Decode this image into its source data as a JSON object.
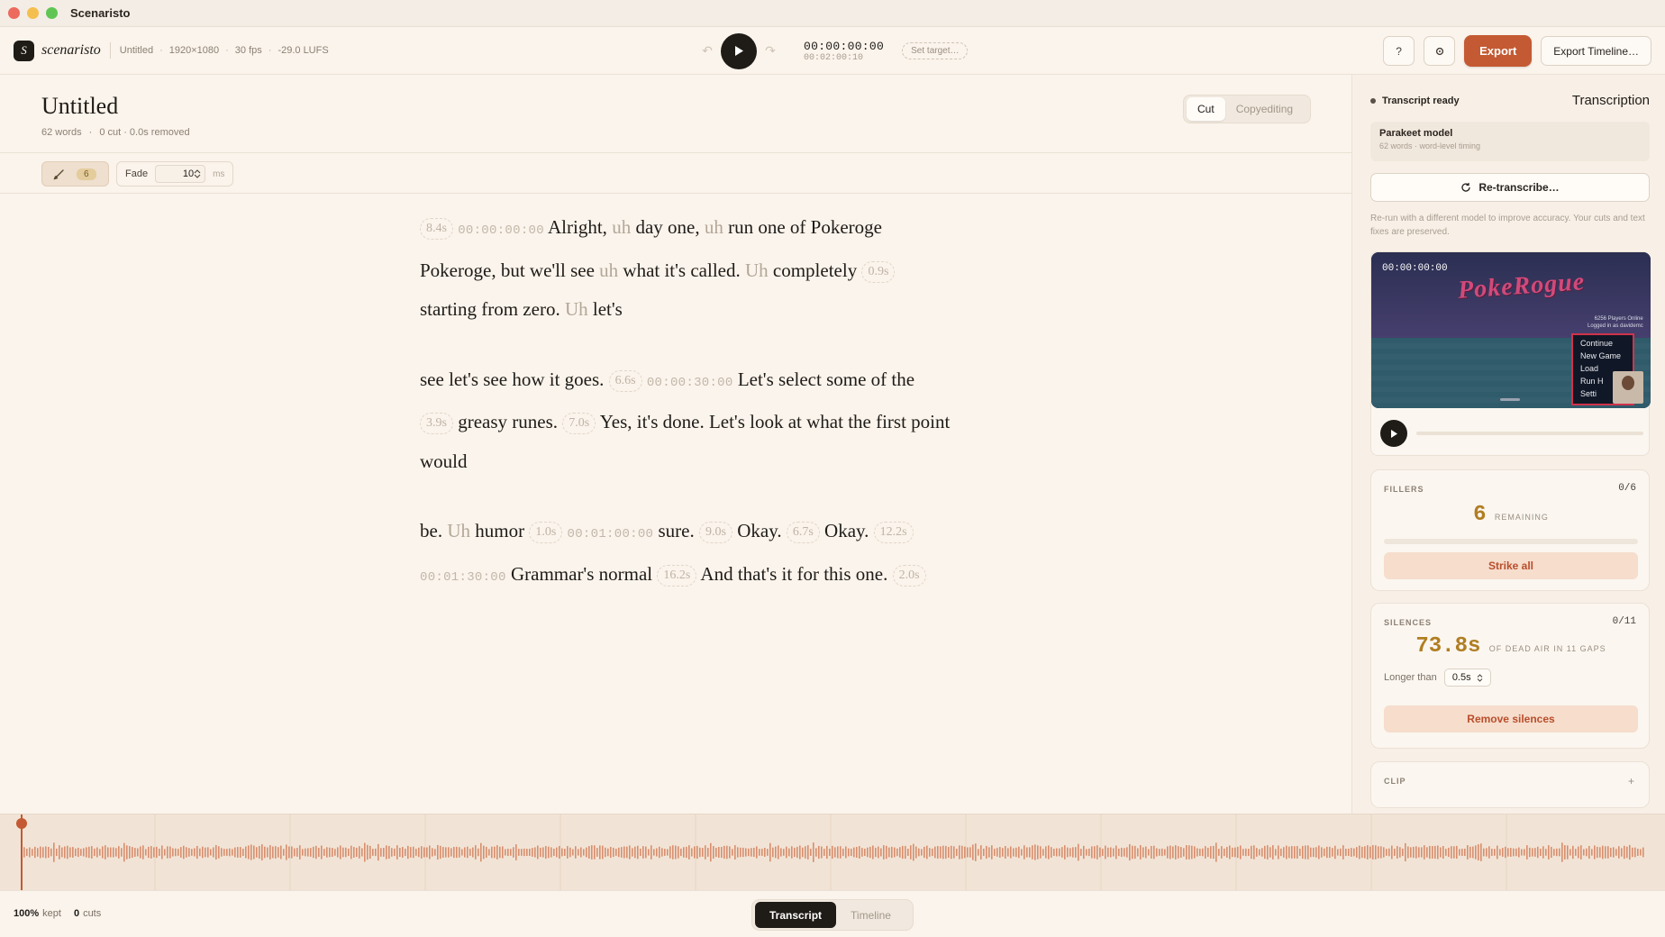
{
  "window": {
    "title": "Scenaristo"
  },
  "header": {
    "logo_letter": "S",
    "brand": "scenaristo",
    "project": "Untitled",
    "resolution": "1920×1080",
    "fps": "30 fps",
    "loudness": "-29.0 LUFS",
    "timecode": "00:00:00:00",
    "duration": "00:02:00:10",
    "set_target": "Set target…",
    "help": "?",
    "export": "Export",
    "export_timeline": "Export Timeline…"
  },
  "document": {
    "title": "Untitled",
    "words": "62 words",
    "cut_summary": "0 cut · 0.0s removed",
    "modes": [
      "Cut",
      "Copyediting"
    ],
    "filler_count": "6",
    "fade_label": "Fade",
    "fade_value": "10",
    "fade_unit": "ms"
  },
  "transcript": {
    "g1": "8.4s",
    "t1": "00:00:00:00",
    "w1": "Alright,",
    "f1": "uh",
    "w2": "day one,",
    "f2": "uh",
    "w3": "run one of Pokeroge Pokeroge, but we'll see",
    "f3": "uh",
    "w4": "what it's called.",
    "f4": "Uh",
    "w5": "completely",
    "g2": "0.9s",
    "w6": "starting from zero.",
    "f5": "Uh",
    "w7": "let's",
    "w8": "see let's see how it goes.",
    "g3": "6.6s",
    "t2": "00:00:30:00",
    "w9": "Let's select some of the",
    "g4": "3.9s",
    "w10": "greasy runes.",
    "g5": "7.0s",
    "w11": "Yes, it's done. Let's look at what the first point would",
    "w12": "be.",
    "f6": "Uh",
    "w13": "humor",
    "g6": "1.0s",
    "t3": "00:01:00:00",
    "w14": "sure.",
    "g7": "9.0s",
    "w15": "Okay.",
    "g8": "6.7s",
    "w16": "Okay.",
    "g9": "12.2s",
    "t4": "00:01:30:00",
    "w17": "Grammar's normal",
    "g10": "16.2s",
    "w18": "And that's it for this one.",
    "g11": "2.0s"
  },
  "sidebar": {
    "status": "Transcript ready",
    "title": "Transcription",
    "model_name": "Parakeet model",
    "model_sub": "62 words · word-level timing",
    "retranscribe": "Re-transcribe…",
    "note": "Re-run with a different model to improve accuracy. Your cuts and text fixes are preserved.",
    "video": {
      "timecode": "00:00:00:00",
      "game_logo": "PokeRogue",
      "online": "6256 Players Online",
      "logged": "Logged in as davidemc",
      "menu": [
        "Continue",
        "New Game",
        "Load",
        "Run H",
        "Setti"
      ]
    },
    "fillers": {
      "label": "FILLERS",
      "count": "0/6",
      "number": "6",
      "caption": "REMAINING",
      "progress": 0,
      "action": "Strike all"
    },
    "silences": {
      "label": "SILENCES",
      "count": "0/11",
      "number": "73.8s",
      "caption": "OF DEAD AIR IN 11 GAPS",
      "longer_label": "Longer than",
      "longer_value": "0.5s",
      "action": "Remove silences"
    },
    "clip": {
      "label": "CLIP",
      "plus": "+"
    }
  },
  "status": {
    "kept_value": "100%",
    "kept_label": "kept",
    "cuts_value": "0",
    "cuts_label": "cuts",
    "tabs": [
      "Transcript",
      "Timeline"
    ]
  },
  "colors": {
    "accent": "#c45a33",
    "filler_gold": "#b07e22",
    "background": "#fbf4ec"
  }
}
